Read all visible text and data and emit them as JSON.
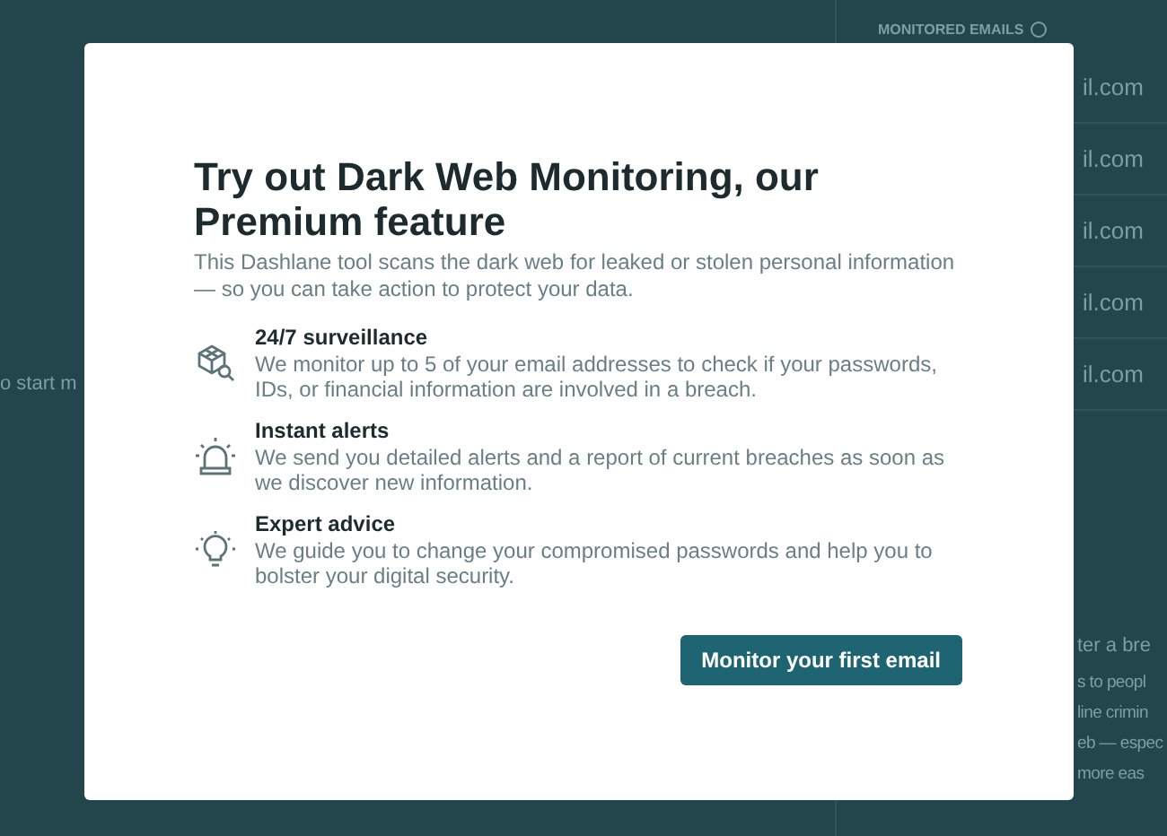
{
  "background": {
    "left_text": "o start m",
    "panel": {
      "heading": "MONITORED EMAILS",
      "rows": [
        "il.com",
        "il.com",
        "il.com",
        "il.com",
        "il.com"
      ],
      "section_title": "ter a bre",
      "section_lines": [
        "s to peopl",
        "line crimin",
        "eb — espec",
        "more eas"
      ]
    }
  },
  "dialog": {
    "title": "Try out Dark Web Monitoring, our Premium feature",
    "intro": "This Dashlane tool scans the dark web for leaked or stolen personal information — so you can take action to protect your data.",
    "features": [
      {
        "kind": "surveillance",
        "title": "24/7 surveillance",
        "text": "We monitor up to 5 of your email addresses to check if your passwords, IDs, or financial information are involved in a breach."
      },
      {
        "kind": "alerts",
        "title": "Instant alerts",
        "text": "We send you detailed alerts and a report of current breaches as soon as we discover new information."
      },
      {
        "kind": "advice",
        "title": "Expert advice",
        "text": "We guide you to change your compromised passwords and help you to bolster your digital security."
      }
    ],
    "button": "Monitor your first email"
  }
}
